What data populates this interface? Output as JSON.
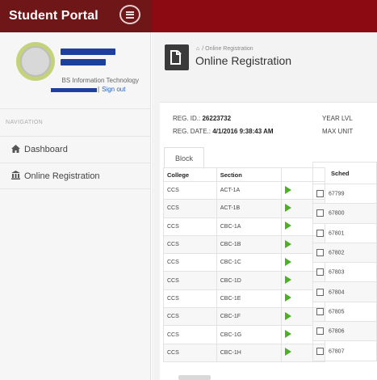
{
  "app": {
    "title": "Student Portal"
  },
  "profile": {
    "program": "BS Information Technology",
    "signout_label": "Sign out"
  },
  "nav": {
    "heading": "NAVIGATION",
    "items": [
      {
        "label": "Dashboard",
        "icon": "home-icon"
      },
      {
        "label": "Online Registration",
        "icon": "bank-icon"
      }
    ]
  },
  "page": {
    "breadcrumb": "Online Registration",
    "title": "Online Registration"
  },
  "registration": {
    "reg_id_label": "REG. ID.:",
    "reg_id_value": "26223732",
    "reg_date_label": "REG. DATE.:",
    "reg_date_value": "4/1/2016 9:38:43 AM",
    "year_level_label": "YEAR LVL",
    "max_units_label": "MAX UNIT"
  },
  "block_tab": {
    "label": "Block"
  },
  "block_table": {
    "headers": [
      "College",
      "Section",
      ""
    ],
    "rows": [
      {
        "college": "CCS",
        "section": "ACT-1A"
      },
      {
        "college": "CCS",
        "section": "ACT-1B"
      },
      {
        "college": "CCS",
        "section": "CBC-1A"
      },
      {
        "college": "CCS",
        "section": "CBC-1B"
      },
      {
        "college": "CCS",
        "section": "CBC-1C"
      },
      {
        "college": "CCS",
        "section": "CBC-1D"
      },
      {
        "college": "CCS",
        "section": "CBC-1E"
      },
      {
        "college": "CCS",
        "section": "CBC-1F"
      },
      {
        "college": "CCS",
        "section": "CBC-1G"
      },
      {
        "college": "CCS",
        "section": "CBC-1H"
      }
    ]
  },
  "schedule_table": {
    "header": "Sched",
    "rows": [
      "67799",
      "67800",
      "67801",
      "67802",
      "67803",
      "67804",
      "67805",
      "67806",
      "67807"
    ]
  },
  "colors": {
    "brand": "#6f1619",
    "topbar": "#8c0a12",
    "accent": "#4caf27"
  }
}
